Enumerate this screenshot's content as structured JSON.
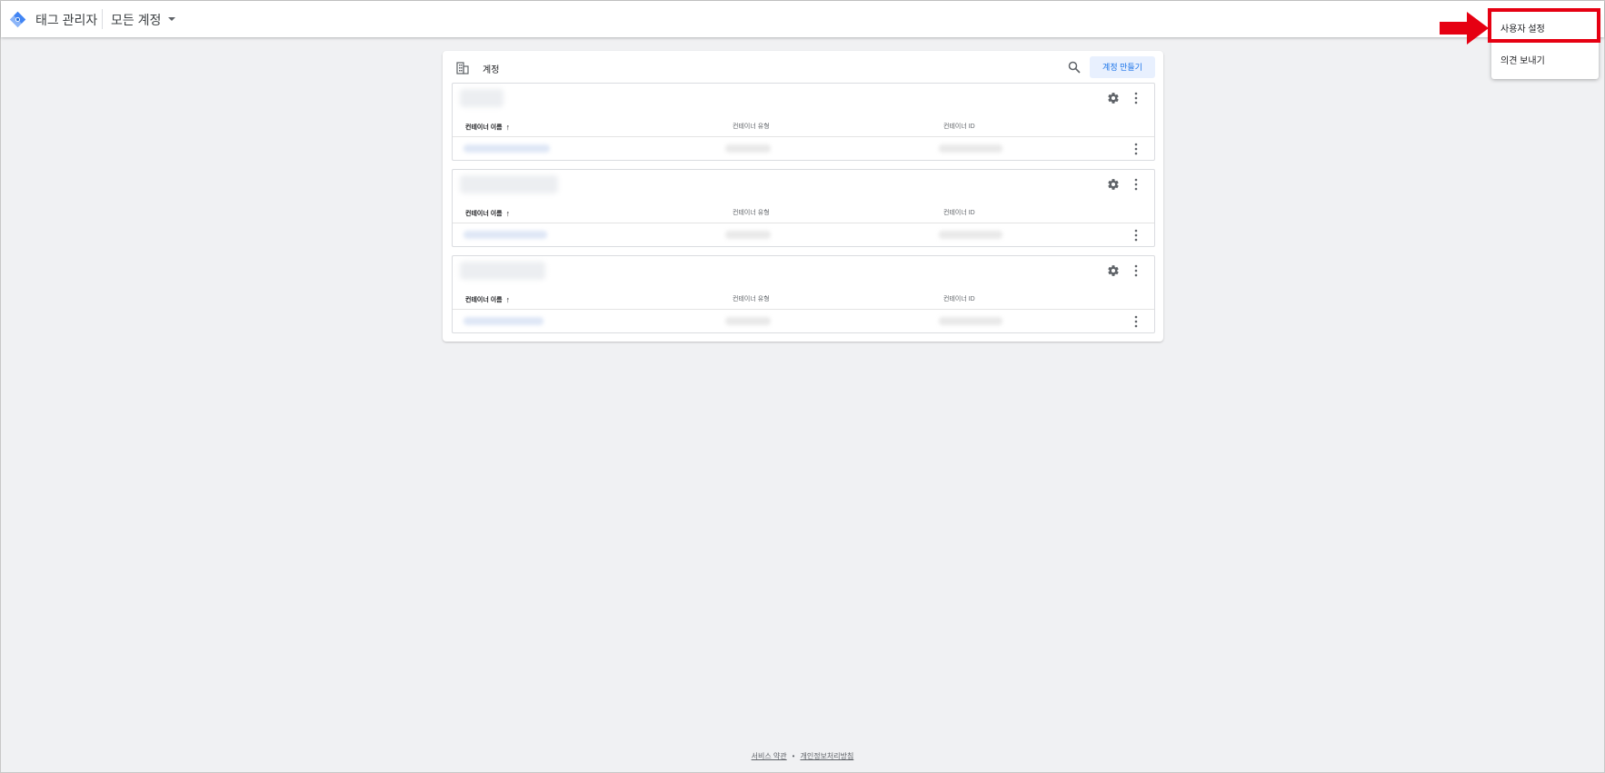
{
  "header": {
    "app_title": "태그 관리자",
    "account_selector": "모든 계정"
  },
  "menu": {
    "items": [
      {
        "label": "사용자 설정"
      },
      {
        "label": "의견 보내기"
      }
    ],
    "highlight_color": "#e60012"
  },
  "accounts_card": {
    "title": "계정",
    "create_button": "계정 만들기",
    "columns": [
      "컨테이너 이름",
      "컨테이너 유형",
      "컨테이너 ID"
    ],
    "sort_indicator": "↑"
  },
  "footer": {
    "terms": "서비스 약관",
    "separator": "•",
    "privacy": "개인정보처리방침"
  },
  "colors": {
    "accent": "#1a73e8",
    "accent_bg": "#e8f0fe",
    "page_bg": "#f0f1f3"
  }
}
